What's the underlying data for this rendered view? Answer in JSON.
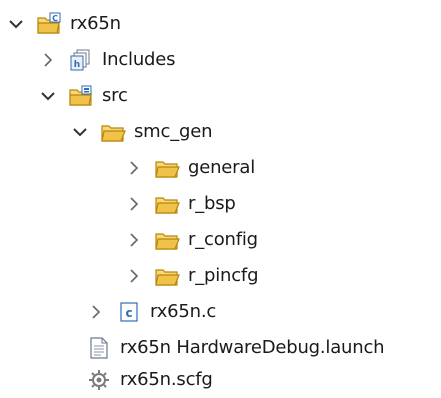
{
  "tree": {
    "project": {
      "label": "rx65n",
      "icon": "c-project-folder-icon"
    },
    "includes": {
      "label": "Includes",
      "icon": "includes-icon"
    },
    "src": {
      "label": "src",
      "icon": "source-folder-icon"
    },
    "smc_gen": {
      "label": "smc_gen",
      "icon": "folder-icon"
    },
    "general": {
      "label": "general",
      "icon": "folder-icon"
    },
    "r_bsp": {
      "label": "r_bsp",
      "icon": "folder-icon"
    },
    "r_config": {
      "label": "r_config",
      "icon": "folder-icon"
    },
    "r_pincfg": {
      "label": "r_pincfg",
      "icon": "folder-icon"
    },
    "rx65n_c": {
      "label": "rx65n.c",
      "icon": "c-file-icon"
    },
    "launch": {
      "label": "rx65n HardwareDebug.launch",
      "icon": "launch-file-icon"
    },
    "scfg": {
      "label": "rx65n.scfg",
      "icon": "gear-file-icon"
    }
  },
  "colors": {
    "folder": "#f0c24a",
    "folder_stroke": "#b8860b",
    "c_blue": "#2f6db5",
    "chevron": "#555555",
    "chevron_open": "#333333"
  }
}
